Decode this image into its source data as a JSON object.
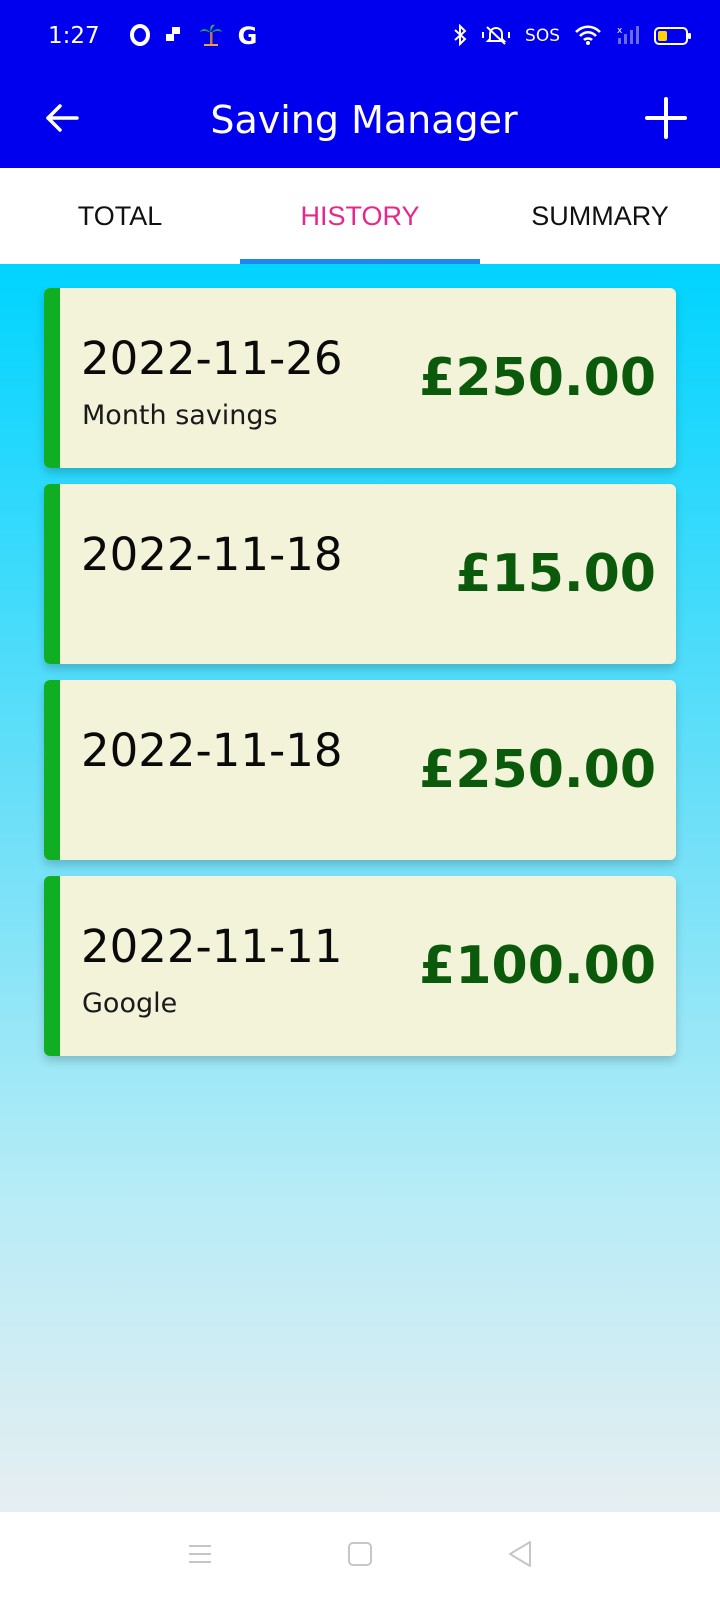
{
  "status_bar": {
    "time": "1:27",
    "left_icons": [
      "opera-icon",
      "app-icon",
      "palm-tree-icon",
      "google-icon"
    ],
    "google_letter": "G",
    "sos_text": "SOS",
    "right_icons": [
      "bluetooth-icon",
      "mute-icon",
      "wifi-icon",
      "signal-icon",
      "battery-icon"
    ]
  },
  "app_bar": {
    "title": "Saving Manager",
    "back_icon": "arrow-left-icon",
    "add_icon": "plus-icon",
    "background": "#0000ee"
  },
  "tabs": [
    {
      "label": "TOTAL",
      "active": false
    },
    {
      "label": "HISTORY",
      "active": true
    },
    {
      "label": "SUMMARY",
      "active": false
    }
  ],
  "colors": {
    "accent_tab": "#e8278a",
    "tab_indicator": "#1e88f0",
    "card_stripe": "#0fae23",
    "card_background": "#f3f3da",
    "amount_text": "#0b5a0b"
  },
  "history": [
    {
      "date": "2022-11-26",
      "note": "Month savings",
      "amount": "£250.00"
    },
    {
      "date": "2022-11-18",
      "note": "",
      "amount": "£15.00"
    },
    {
      "date": "2022-11-18",
      "note": "",
      "amount": "£250.00"
    },
    {
      "date": "2022-11-11",
      "note": "Google",
      "amount": "£100.00"
    }
  ],
  "nav_bar": {
    "icons": [
      "menu-icon",
      "home-square-icon",
      "back-triangle-icon"
    ]
  }
}
